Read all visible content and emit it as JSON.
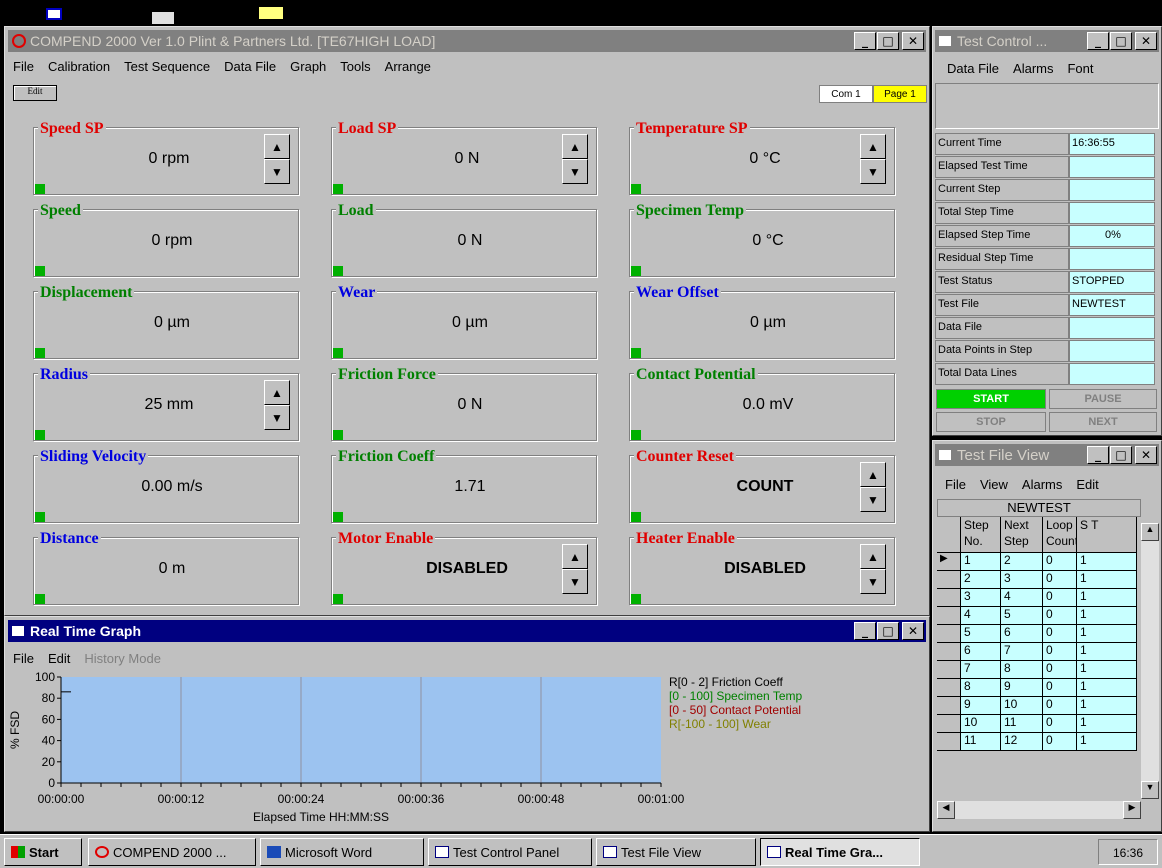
{
  "main_window": {
    "title": "COMPEND 2000 Ver 1.0 Plint & Partners Ltd.  [TE67HIGH LOAD]",
    "menu": [
      "File",
      "Calibration",
      "Test Sequence",
      "Data File",
      "Graph",
      "Tools",
      "Arrange"
    ],
    "edit_btn": "Edit",
    "com_label": "Com 1",
    "page_label": "Page 1",
    "panels": [
      {
        "label": "Speed SP",
        "value": "0 rpm",
        "color": "red",
        "spin": true
      },
      {
        "label": "Load SP",
        "value": "0 N",
        "color": "red",
        "spin": true
      },
      {
        "label": "Temperature SP",
        "value": "0 °C",
        "color": "red",
        "spin": true
      },
      {
        "label": "Speed",
        "value": "0 rpm",
        "color": "green",
        "spin": false
      },
      {
        "label": "Load",
        "value": "0 N",
        "color": "green",
        "spin": false
      },
      {
        "label": "Specimen Temp",
        "value": "0 °C",
        "color": "green",
        "spin": false
      },
      {
        "label": "Displacement",
        "value": "0 µm",
        "color": "green",
        "spin": false
      },
      {
        "label": "Wear",
        "value": "0 µm",
        "color": "blue",
        "spin": false
      },
      {
        "label": "Wear Offset",
        "value": "0 µm",
        "color": "blue",
        "spin": false
      },
      {
        "label": "Radius",
        "value": "25 mm",
        "color": "blue",
        "spin": true
      },
      {
        "label": "Friction Force",
        "value": "0 N",
        "color": "green",
        "spin": false
      },
      {
        "label": "Contact Potential",
        "value": "0.0 mV",
        "color": "green",
        "spin": false
      },
      {
        "label": "Sliding Velocity",
        "value": "0.00 m/s",
        "color": "blue",
        "spin": false
      },
      {
        "label": "Friction Coeff",
        "value": "1.71",
        "color": "green",
        "spin": false
      },
      {
        "label": "Counter Reset",
        "value": "COUNT",
        "color": "red",
        "spin": true
      },
      {
        "label": "Distance",
        "value": "0 m",
        "color": "blue",
        "spin": false
      },
      {
        "label": "Motor Enable",
        "value": "DISABLED",
        "color": "red",
        "spin": true
      },
      {
        "label": "Heater Enable",
        "value": "DISABLED",
        "color": "red",
        "spin": true
      }
    ]
  },
  "graph_window": {
    "title": "Real Time Graph",
    "menu": [
      "File",
      "Edit",
      "History Mode"
    ],
    "ylabel": "% FSD",
    "xlabel": "Elapsed Time HH:MM:SS",
    "yticks": [
      "100",
      "80",
      "60",
      "40",
      "20",
      "0"
    ],
    "xticks": [
      "00:00:00",
      "00:00:12",
      "00:00:24",
      "00:00:36",
      "00:00:48",
      "00:01:00"
    ],
    "legend": [
      {
        "text": "R[0 - 2]  Friction Coeff",
        "color": "#000000"
      },
      {
        "text": "[0 - 100]  Specimen Temp",
        "color": "#008000"
      },
      {
        "text": "[0 - 50]  Contact Potential",
        "color": "#a00000"
      },
      {
        "text": "R[-100 - 100]  Wear",
        "color": "#808000"
      }
    ]
  },
  "chart_data": {
    "type": "line",
    "xlabel": "Elapsed Time HH:MM:SS",
    "ylabel": "% FSD",
    "ylim": [
      0,
      100
    ],
    "x_ticks": [
      "00:00:00",
      "00:00:12",
      "00:00:24",
      "00:00:36",
      "00:00:48",
      "00:01:00"
    ],
    "series": [
      {
        "name": "R[0 - 2]  Friction Coeff",
        "x": [
          "00:00:00",
          "00:00:01"
        ],
        "values": [
          86,
          86
        ]
      }
    ]
  },
  "test_control": {
    "title": "Test Control ...",
    "menu": [
      "Data File",
      "Alarms",
      "Font"
    ],
    "rows": [
      {
        "label": "Current Time",
        "value": "16:36:55"
      },
      {
        "label": "Elapsed Test Time",
        "value": ""
      },
      {
        "label": "Current Step",
        "value": ""
      },
      {
        "label": "Total Step Time",
        "value": ""
      },
      {
        "label": "Elapsed Step Time",
        "value": "0%"
      },
      {
        "label": "Residual Step Time",
        "value": ""
      },
      {
        "label": "Test Status",
        "value": "STOPPED"
      },
      {
        "label": "Test File",
        "value": "NEWTEST"
      },
      {
        "label": "Data File",
        "value": ""
      },
      {
        "label": "Data Points in Step",
        "value": ""
      },
      {
        "label": "Total Data Lines",
        "value": ""
      }
    ],
    "start": "START",
    "pause": "PAUSE",
    "stop": "STOP",
    "next": "NEXT"
  },
  "test_file_view": {
    "title": "Test File View",
    "menu": [
      "File",
      "View",
      "Alarms",
      "Edit"
    ],
    "file_name": "NEWTEST",
    "headers": [
      "Step No.",
      "Next Step",
      "Loop Count",
      "S T"
    ],
    "rows": [
      [
        "1",
        "2",
        "0",
        "1"
      ],
      [
        "2",
        "3",
        "0",
        "1"
      ],
      [
        "3",
        "4",
        "0",
        "1"
      ],
      [
        "4",
        "5",
        "0",
        "1"
      ],
      [
        "5",
        "6",
        "0",
        "1"
      ],
      [
        "6",
        "7",
        "0",
        "1"
      ],
      [
        "7",
        "8",
        "0",
        "1"
      ],
      [
        "8",
        "9",
        "0",
        "1"
      ],
      [
        "9",
        "10",
        "0",
        "1"
      ],
      [
        "10",
        "11",
        "0",
        "1"
      ],
      [
        "11",
        "12",
        "0",
        "1"
      ]
    ]
  },
  "taskbar": {
    "start": "Start",
    "buttons": [
      "COMPEND 2000 ...",
      "Microsoft Word",
      "Test Control Panel",
      "Test File View",
      "Real Time Gra..."
    ],
    "clock": "16:36"
  }
}
